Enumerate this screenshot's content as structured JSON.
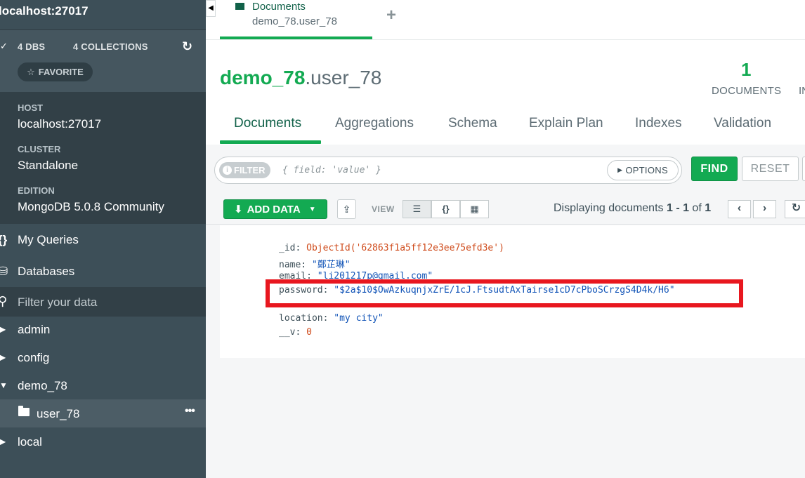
{
  "sidebar": {
    "title": "localhost:27017",
    "dbs_count": "4",
    "dbs_label": "DBS",
    "collections_count": "4",
    "collections_label": "COLLECTIONS",
    "favorite_label": "FAVORITE",
    "host_label": "HOST",
    "host_value": "localhost:27017",
    "cluster_label": "CLUSTER",
    "cluster_value": "Standalone",
    "edition_label": "EDITION",
    "edition_value": "MongoDB 5.0.8 Community",
    "my_queries": "My Queries",
    "databases": "Databases",
    "filter_placeholder": "Filter your data",
    "dbs": [
      "admin",
      "config",
      "demo_78",
      "local"
    ],
    "active_collection": "user_78"
  },
  "tabbar": {
    "tab_title": "Documents",
    "tab_subtitle": "demo_78.user_78"
  },
  "header": {
    "db_name": "demo_78",
    "collection_name": ".user_78",
    "doc_count": "1",
    "doc_count_label": "DOCUMENTS",
    "second_stat_label": "IN"
  },
  "subtabs": [
    "Documents",
    "Aggregations",
    "Schema",
    "Explain Plan",
    "Indexes",
    "Validation"
  ],
  "query": {
    "filter_badge": "FILTER",
    "placeholder": "{ field: 'value' }",
    "options_label": "OPTIONS",
    "find_label": "FIND",
    "reset_label": "RESET"
  },
  "toolbar": {
    "add_data_label": "ADD DATA",
    "view_label": "VIEW",
    "display_prefix": "Displaying documents ",
    "display_range": "1 - 1",
    "display_of": " of ",
    "display_total": "1"
  },
  "document": {
    "id_key": "_id:",
    "id_value": "ObjectId('62863f1a5ff12e3ee75efd3e')",
    "name_key": "name:",
    "name_value": "\"鄭芷琳\"",
    "email_key": "email:",
    "email_value": "\"li201217p@gmail.com\"",
    "password_key": "password:",
    "password_value": "\"$2a$10$OwAzkuqnjxZrE/1cJ.FtsudtAxTairse1cD7cPboSCrzgS4D4k/H6\"",
    "location_key": "location:",
    "location_value": "\"my city\"",
    "v_key": "__v:",
    "v_value": "0"
  },
  "colors": {
    "accent": "#13aa52",
    "dark_green": "#116149",
    "sidebar": "#3d4f58",
    "highlight": "#e8171f"
  }
}
